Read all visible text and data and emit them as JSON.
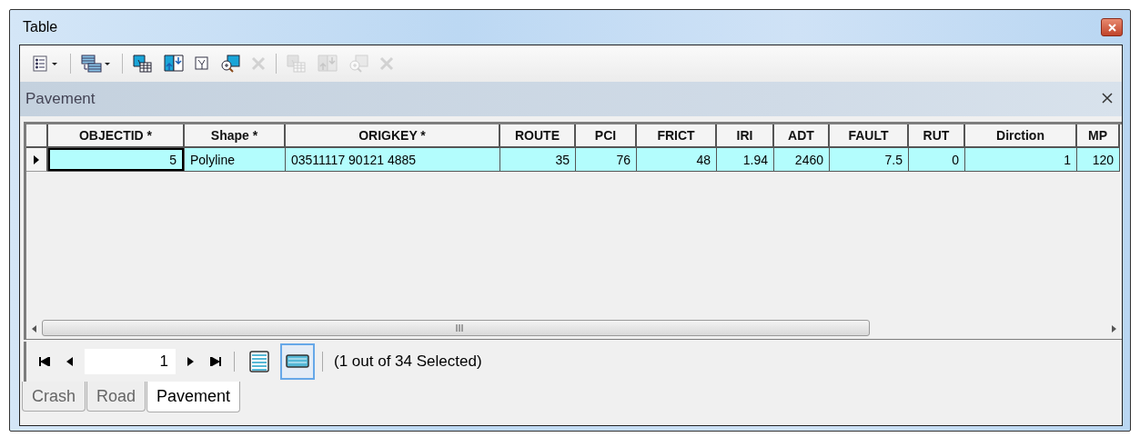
{
  "window": {
    "title": "Table"
  },
  "toolbar": [
    {
      "kind": "options",
      "disabled": false
    },
    {
      "kind": "separator"
    },
    {
      "kind": "related",
      "disabled": false
    },
    {
      "kind": "separator"
    },
    {
      "kind": "select",
      "disabled": false
    },
    {
      "kind": "switch",
      "disabled": false
    },
    {
      "kind": "clear",
      "disabled": false
    },
    {
      "kind": "zoom",
      "disabled": false
    },
    {
      "kind": "delete",
      "disabled": true
    },
    {
      "kind": "separator"
    },
    {
      "kind": "select",
      "disabled": true
    },
    {
      "kind": "switch",
      "disabled": true
    },
    {
      "kind": "zoom",
      "disabled": true
    },
    {
      "kind": "delete",
      "disabled": true
    }
  ],
  "panel": {
    "title": "Pavement"
  },
  "table": {
    "columns": [
      {
        "label": "OBJECTID *",
        "kind": "number"
      },
      {
        "label": "Shape *",
        "kind": "text"
      },
      {
        "label": "ORIGKEY *",
        "kind": "text"
      },
      {
        "label": "ROUTE",
        "kind": "number"
      },
      {
        "label": "PCI",
        "kind": "number"
      },
      {
        "label": "FRICT",
        "kind": "number"
      },
      {
        "label": "IRI",
        "kind": "number"
      },
      {
        "label": "ADT",
        "kind": "number"
      },
      {
        "label": "FAULT",
        "kind": "number"
      },
      {
        "label": "RUT",
        "kind": "number"
      },
      {
        "label": "Dirction",
        "kind": "number"
      },
      {
        "label": "MP",
        "kind": "number"
      }
    ],
    "rows": [
      {
        "selected": true,
        "cells": [
          "5",
          "Polyline",
          "03511117 90121 4885",
          "35",
          "76",
          "48",
          "1.94",
          "2460",
          "7.5",
          "0",
          "1",
          "120"
        ]
      }
    ]
  },
  "navigator": {
    "record": "1",
    "status": "(1 out of 34 Selected)",
    "views": [
      {
        "kind": "all",
        "selected": false
      },
      {
        "kind": "selected",
        "selected": true
      }
    ]
  },
  "tabs": [
    {
      "label": "Crash",
      "selected": false
    },
    {
      "label": "Road",
      "selected": false
    },
    {
      "label": "Pavement",
      "selected": true
    }
  ]
}
